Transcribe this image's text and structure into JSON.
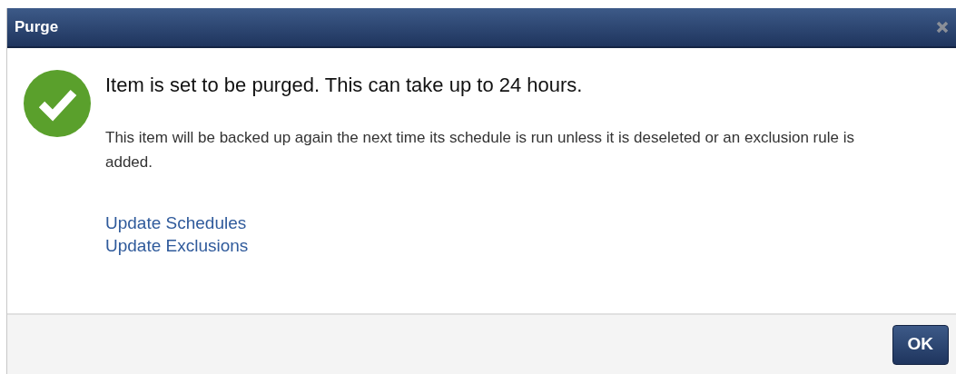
{
  "dialog": {
    "title": "Purge",
    "message": "Item is set to be purged. This can take up to 24 hours.",
    "detail": "This item will be backed up again the next time its schedule is run unless it is deseleted or an exclusion rule is added.",
    "links": [
      "Update Schedules",
      "Update Exclusions"
    ],
    "buttons": [
      "OK"
    ]
  }
}
